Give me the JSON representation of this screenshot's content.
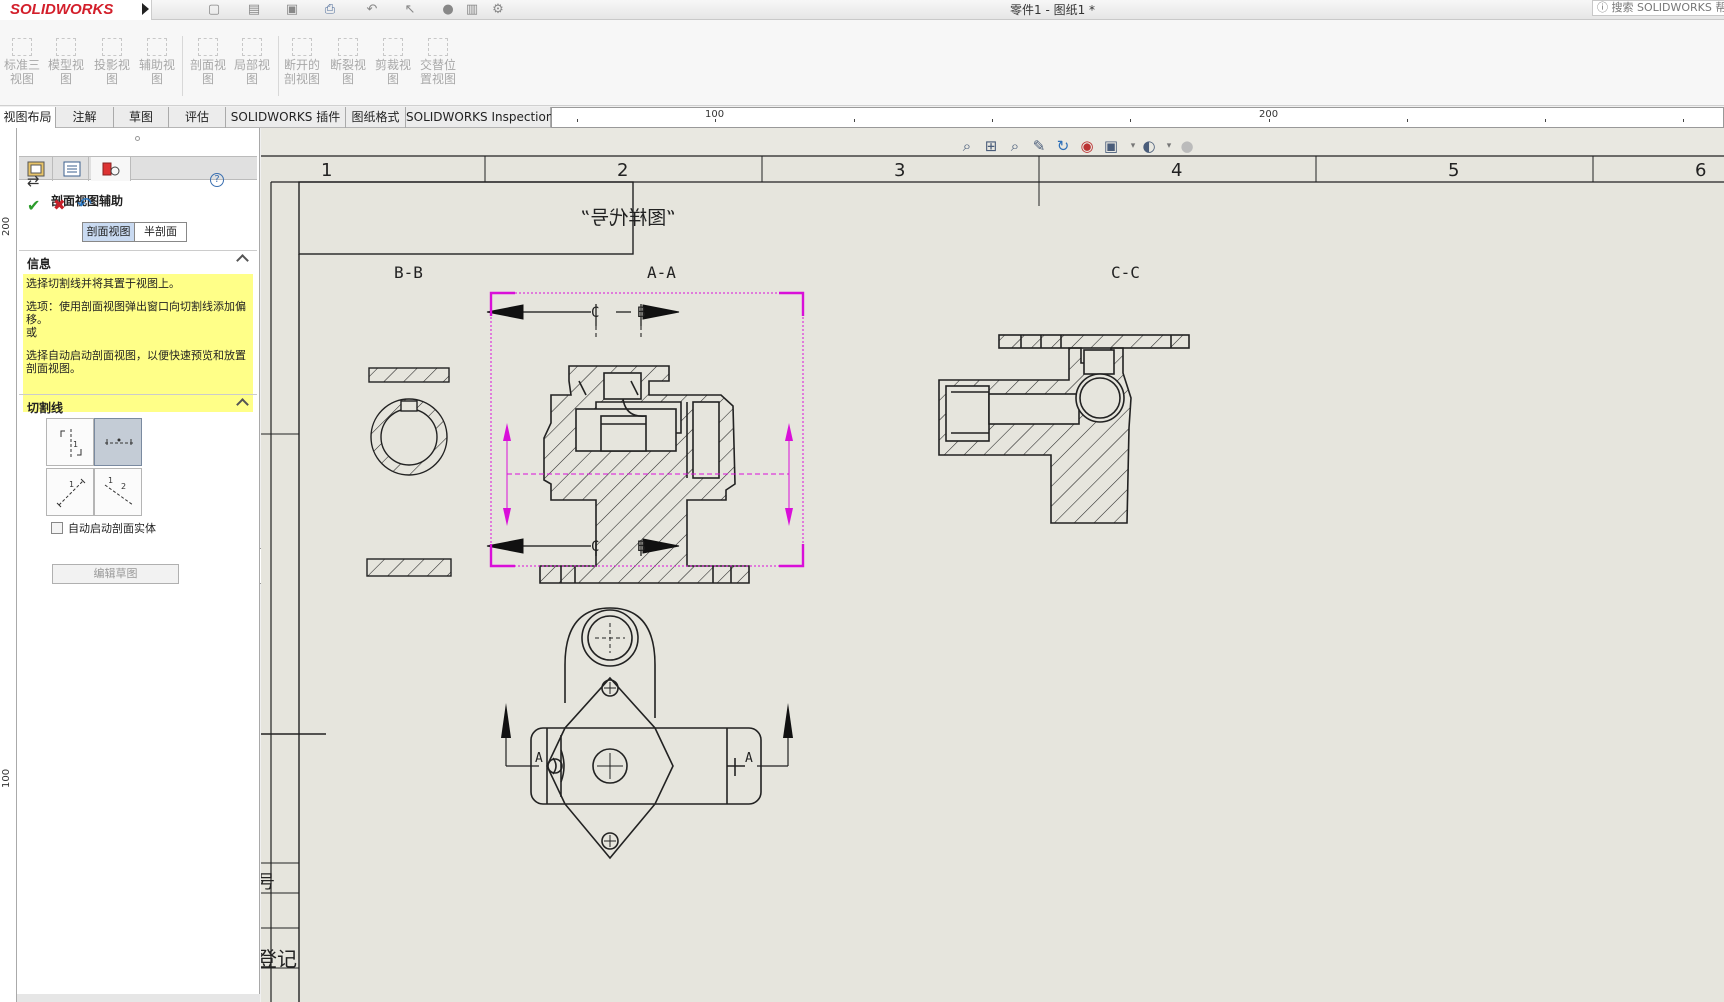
{
  "app": {
    "logo_text": "SOLIDWORKS",
    "title": "零件1 - 图纸1 *",
    "search_placeholder": "搜索 SOLIDWORKS 帮助"
  },
  "command_manager": [
    {
      "label": "标准三视图",
      "icon": "standard-three-view-icon"
    },
    {
      "label": "模型视图",
      "icon": "model-view-icon"
    },
    {
      "label": "投影视图",
      "icon": "projected-view-icon"
    },
    {
      "label": "辅助视图",
      "icon": "auxiliary-view-icon"
    },
    {
      "label": "剖面视图",
      "icon": "section-view-icon"
    },
    {
      "label": "局部视图",
      "icon": "detail-view-icon"
    },
    {
      "label": "断开的剖视图",
      "icon": "broken-out-section-icon"
    },
    {
      "label": "断裂视图",
      "icon": "break-view-icon"
    },
    {
      "label": "剪裁视图",
      "icon": "crop-view-icon"
    },
    {
      "label": "交替位置视图",
      "icon": "alternate-position-view-icon"
    }
  ],
  "tabs": [
    "视图布局",
    "注解",
    "草图",
    "评估",
    "SOLIDWORKS 插件",
    "图纸格式",
    "SOLIDWORKS Inspection"
  ],
  "ruler": {
    "top_labels": [
      "100",
      "200"
    ],
    "left_labels": [
      "200",
      "100"
    ]
  },
  "property_manager": {
    "title": "剖面视图辅助",
    "modes": {
      "section": "剖面视图",
      "half": "半剖面"
    },
    "info_heading": "信息",
    "info_lines": [
      "选择切割线并将其置于视图上。",
      "选项：使用剖面视图弹出窗口向切割线添加偏移。\n或",
      "选择自动启动剖面视图，以便快速预览和放置剖面视图。"
    ],
    "cutting_line_heading": "切割线",
    "auto_start_label": "自动启动剖面实体",
    "edit_sketch_label": "编辑草图"
  },
  "drawing": {
    "zone_numbers": [
      "1",
      "2",
      "3",
      "4",
      "5",
      "6"
    ],
    "mirror_text": "“图样代号”",
    "view_labels": {
      "bb": "B-B",
      "aa": "A-A",
      "cc": "C-C"
    },
    "cut_labels": {
      "c": "C",
      "b": "B",
      "a": "A"
    },
    "title_block": {
      "fragment_1": "号",
      "fragment_2": "登记"
    }
  },
  "colors": {
    "canvas": "#e6e5dd",
    "selection": "#d90fd9",
    "info_bg": "#ffff88",
    "accent": "#d31f2b"
  }
}
